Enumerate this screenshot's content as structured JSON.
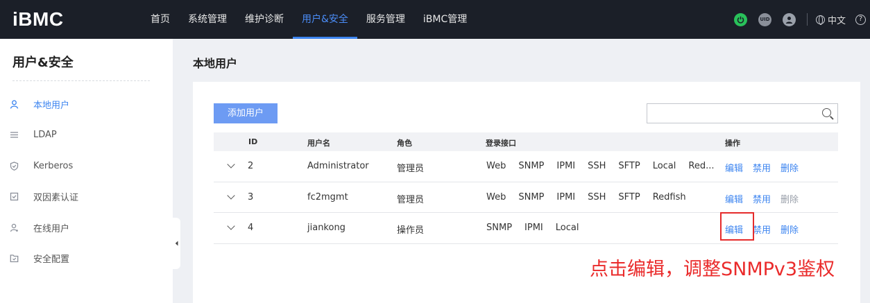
{
  "app": {
    "logo": "iBMC"
  },
  "nav": [
    "首页",
    "系统管理",
    "维护诊断",
    "用户&安全",
    "服务管理",
    "iBMC管理"
  ],
  "header_right": {
    "uid_label": "UID",
    "language": "中文",
    "help": "?"
  },
  "sidebar": {
    "title": "用户&安全",
    "items": [
      {
        "label": "本地用户",
        "icon": "user-icon"
      },
      {
        "label": "LDAP",
        "icon": "list-icon"
      },
      {
        "label": "Kerberos",
        "icon": "shield-icon"
      },
      {
        "label": "双因素认证",
        "icon": "check-box-icon"
      },
      {
        "label": "在线用户",
        "icon": "online-user-icon"
      },
      {
        "label": "安全配置",
        "icon": "folder-icon"
      }
    ]
  },
  "main": {
    "page_title": "本地用户",
    "add_button": "添加用户",
    "search_placeholder": "",
    "table": {
      "headers": [
        "ID",
        "用户名",
        "角色",
        "登录接口",
        "操作"
      ],
      "rows": [
        {
          "id": "2",
          "username": "Administrator",
          "role": "管理员",
          "interfaces": [
            "Web",
            "SNMP",
            "IPMI",
            "SSH",
            "SFTP",
            "Local",
            "Red..."
          ]
        },
        {
          "id": "3",
          "username": "fc2mgmt",
          "role": "管理员",
          "interfaces": [
            "Web",
            "SNMP",
            "IPMI",
            "SSH",
            "SFTP",
            "Redfish"
          ]
        },
        {
          "id": "4",
          "username": "jiankong",
          "role": "操作员",
          "interfaces": [
            "SNMP",
            "IPMI",
            "Local"
          ]
        }
      ],
      "actions": {
        "edit": "编辑",
        "disable": "禁用",
        "delete": "删除"
      }
    }
  },
  "annotation": "点击编辑，调整SNMPv3鉴权",
  "colors": {
    "accent": "#3d85f0",
    "topbar": "#1b1f28",
    "annotation": "#ea2b2b",
    "power": "#29c15a"
  }
}
